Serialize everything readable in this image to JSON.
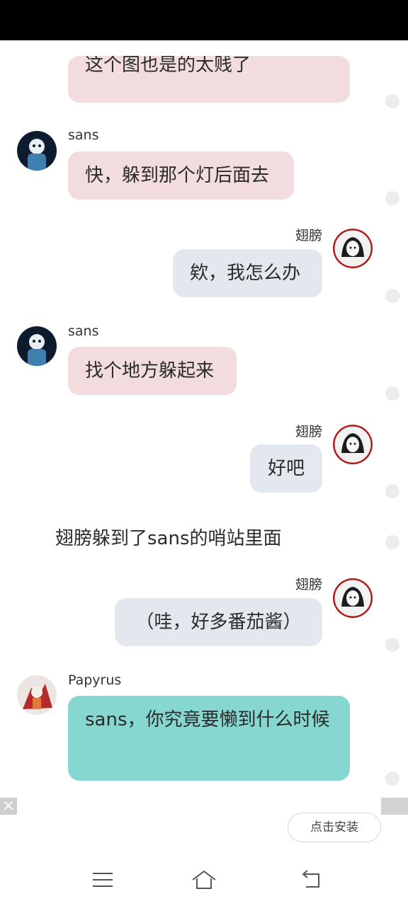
{
  "messages": [
    {
      "side": "left",
      "speaker": "",
      "text": "这个图也是的太贱了",
      "color": "#f2dcdd"
    },
    {
      "side": "left",
      "speaker": "sans",
      "text": "快，躲到那个灯后面去",
      "color": "#f2dcdd"
    },
    {
      "side": "right",
      "speaker": "翅膀",
      "text": "欸，我怎么办",
      "color": "#e2e8ee"
    },
    {
      "side": "left",
      "speaker": "sans",
      "text": "找个地方躲起来",
      "color": "#f2dcdd"
    },
    {
      "side": "right",
      "speaker": "翅膀",
      "text": "好吧",
      "color": "#e2e8ee"
    },
    {
      "side": "narration",
      "text": "翅膀躲到了sans的哨站里面"
    },
    {
      "side": "right",
      "speaker": "翅膀",
      "text": "（哇，好多番茄酱）",
      "color": "#e2e8ee"
    },
    {
      "side": "left",
      "speaker": "Papyrus",
      "text": "sans，你究竟要懒到什么时候",
      "color": "#86d7cf"
    }
  ],
  "ad": {
    "close_icon": "×",
    "install_label": "点击安装"
  },
  "nav": {
    "icons": [
      "menu-icon",
      "home-icon",
      "back-icon"
    ]
  }
}
